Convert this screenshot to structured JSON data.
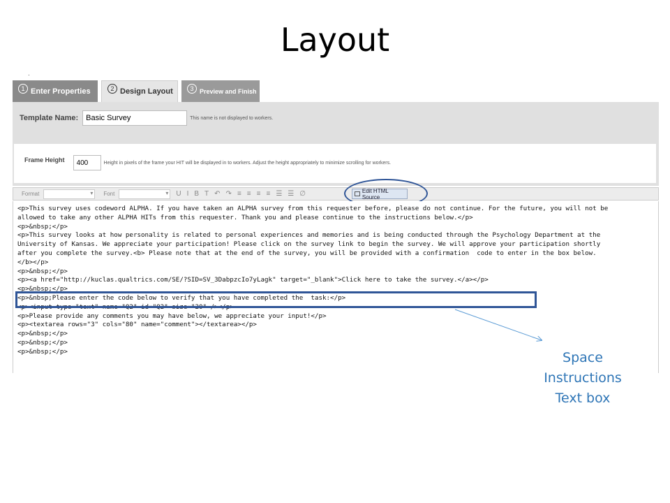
{
  "slide": {
    "title": "Layout",
    "dot": "."
  },
  "tabs": [
    {
      "num": "1",
      "label": "Enter Properties"
    },
    {
      "num": "2",
      "label": "Design Layout"
    },
    {
      "num": "3",
      "label": "Preview and Finish"
    }
  ],
  "form": {
    "template_name_label": "Template Name:",
    "template_name_value": "Basic Survey",
    "template_name_hint": "This name is not displayed to workers.",
    "frame_height_label": "Frame Height",
    "frame_height_value": "400",
    "frame_height_hint": "Height in pixels of the frame your HIT will be displayed in to workers. Adjust the height appropriately to minimize scrolling for workers."
  },
  "toolbar": {
    "format_label": "Format",
    "font_label": "Font",
    "edit_html_label": "Edit HTML Source"
  },
  "editor": {
    "lines": [
      "<p>This survey uses codeword ALPHA. If you have taken an ALPHA survey from this requester before, please do not continue. For the future, you will not be",
      "allowed to take any other ALPHA HITs from this requester. Thank you and please continue to the instructions below.</p>",
      "<p>&nbsp;</p>",
      "<p>This survey looks at how personality is related to personal experiences and memories and is being conducted through the Psychology Department at the",
      "University of Kansas. We appreciate your participation! Please click on the survey link to begin the survey. We will approve your participation shortly",
      "after you complete the survey.<b> Please note that at the end of the survey, you will be provided with a confirmation  code to enter in the box below.",
      "</b></p>",
      "<p>&nbsp;</p>",
      "<p><a href=\"http://kuclas.qualtrics.com/SE/?SID=SV_3DabpzcIo7yLagk\" target=\"_blank\">Click here to take the survey.</a></p>",
      "<p>&nbsp;</p>",
      "<p>&nbsp;Please enter the code below to verify that you have completed the  task:</p>",
      "<p><input type=\"text\" name=\"Q2\" id=\"Q2\" size=\"20\" /></p>",
      "<p>Please provide any comments you may have below, we appreciate your input!</p>",
      "<p><textarea rows=\"3\" cols=\"80\" name=\"comment\"></textarea></p>",
      "<p>&nbsp;</p>",
      "<p>&nbsp;</p>",
      "<p>&nbsp;</p>"
    ]
  },
  "annotation": {
    "lines": [
      "Space",
      "Instructions",
      "Text box"
    ],
    "color": "#2e75b6"
  },
  "colors": {
    "highlight": "#2f5597"
  }
}
